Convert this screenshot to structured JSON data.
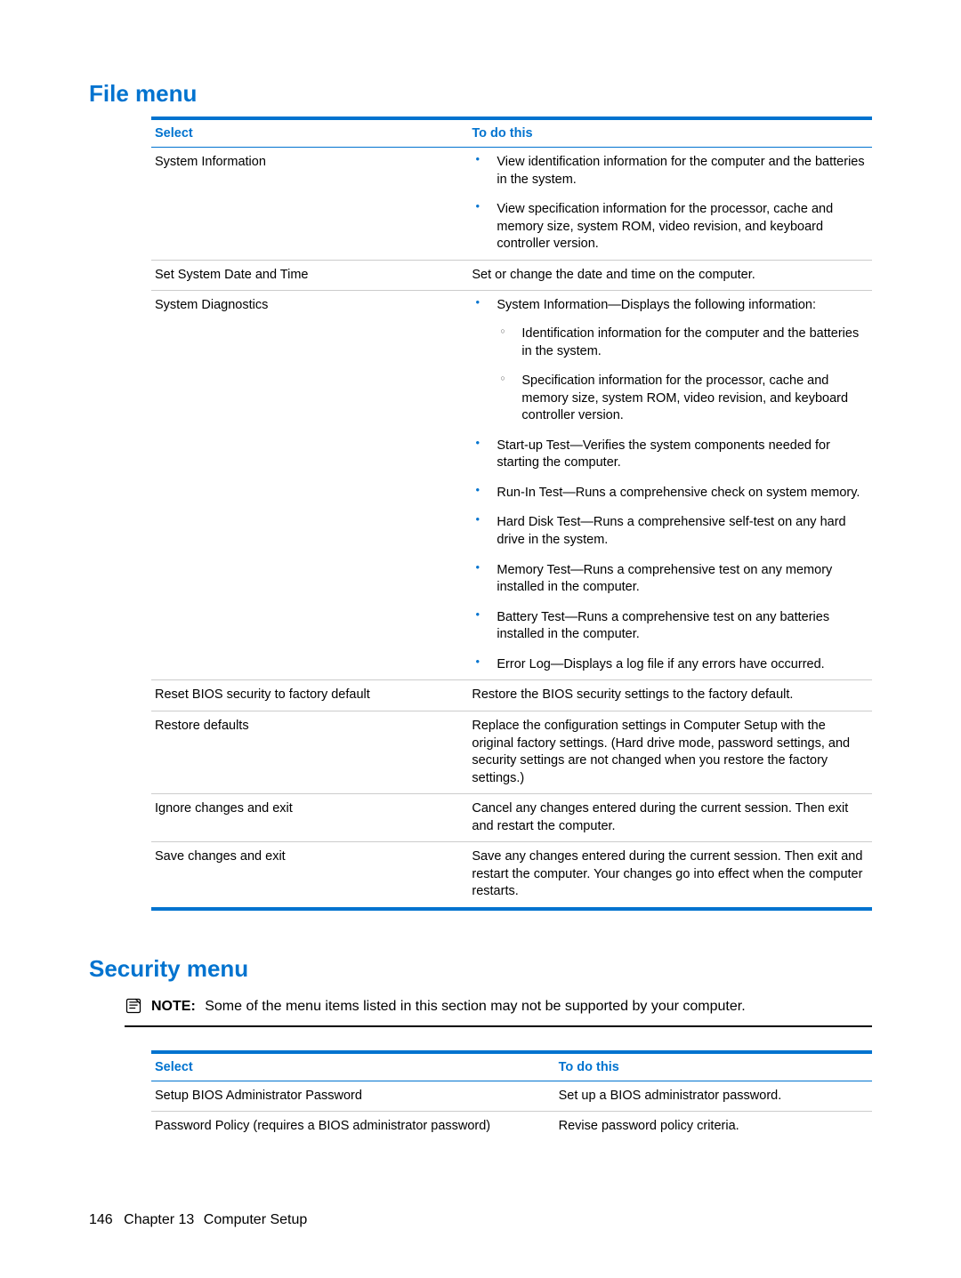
{
  "sections": {
    "file": {
      "heading": "File menu",
      "headers": {
        "select": "Select",
        "todo": "To do this"
      },
      "rows": {
        "r0": {
          "select": "System Information",
          "b0": "View identification information for the computer and the batteries in the system.",
          "b1": "View specification information for the processor, cache and memory size, system ROM, video revision, and keyboard controller version."
        },
        "r1": {
          "select": "Set System Date and Time",
          "todo": "Set or change the date and time on the computer."
        },
        "r2": {
          "select": "System Diagnostics",
          "b0": "System Information—Displays the following information:",
          "b0s0": "Identification information for the computer and the batteries in the system.",
          "b0s1": "Specification information for the processor, cache and memory size, system ROM, video revision, and keyboard controller version.",
          "b1": "Start-up Test—Verifies the system components needed for starting the computer.",
          "b2": "Run-In Test—Runs a comprehensive check on system memory.",
          "b3": "Hard Disk Test—Runs a comprehensive self-test on any hard drive in the system.",
          "b4": "Memory Test—Runs a comprehensive test on any memory installed in the computer.",
          "b5": "Battery Test—Runs a comprehensive test on any batteries installed in the computer.",
          "b6": "Error Log—Displays a log file if any errors have occurred."
        },
        "r3": {
          "select": "Reset BIOS security to factory default",
          "todo": "Restore the BIOS security settings to the factory default."
        },
        "r4": {
          "select": "Restore defaults",
          "todo": "Replace the configuration settings in Computer Setup with the original factory settings. (Hard drive mode, password settings, and security settings are not changed when you restore the factory settings.)"
        },
        "r5": {
          "select": "Ignore changes and exit",
          "todo": "Cancel any changes entered during the current session. Then exit and restart the computer."
        },
        "r6": {
          "select": "Save changes and exit",
          "todo": "Save any changes entered during the current session. Then exit and restart the computer. Your changes go into effect when the computer restarts."
        }
      }
    },
    "security": {
      "heading": "Security menu",
      "note_label": "NOTE:",
      "note_text": "Some of the menu items listed in this section may not be supported by your computer.",
      "headers": {
        "select": "Select",
        "todo": "To do this"
      },
      "rows": {
        "r0": {
          "select": "Setup BIOS Administrator Password",
          "todo": "Set up a BIOS administrator password."
        },
        "r1": {
          "select": "Password Policy (requires a BIOS administrator password)",
          "todo": "Revise password policy criteria."
        }
      }
    }
  },
  "footer": {
    "page": "146",
    "chapter_label": "Chapter 13",
    "chapter_title": "Computer Setup"
  }
}
